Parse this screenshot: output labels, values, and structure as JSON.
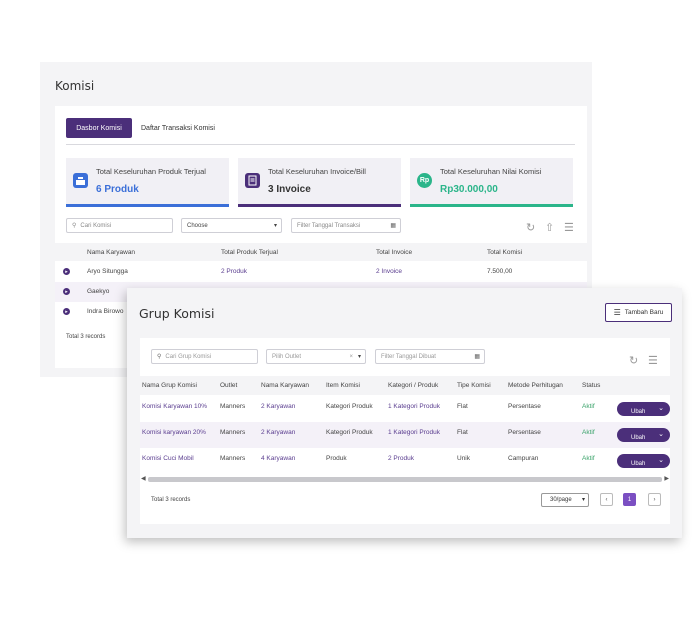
{
  "komisi": {
    "title": "Komisi",
    "tabs": [
      {
        "label": "Dasbor Komisi"
      },
      {
        "label": "Daftar Transaksi Komisi"
      }
    ],
    "stats": [
      {
        "label": "Total Keseluruhan Produk Terjual",
        "value": "6 Produk",
        "icon": "cash-register-icon",
        "color": "#3b6fd8"
      },
      {
        "label": "Total Keseluruhan Invoice/Bill",
        "value": "3 Invoice",
        "icon": "invoice-icon",
        "color": "#4b2f7a"
      },
      {
        "label": "Total Keseluruhan Nilai Komisi",
        "value": "Rp30.000,00",
        "icon": "money-bag-icon",
        "color": "#2bb58a"
      }
    ],
    "filters": {
      "search_placeholder": "Cari Komisi",
      "choose": "Choose",
      "date_placeholder": "Filter Tanggal Transaksi"
    },
    "table": {
      "headers": [
        "Nama Karyawan",
        "Total Produk Terjual",
        "Total Invoice",
        "Total Komisi"
      ],
      "rows": [
        [
          "Aryo Situngga",
          "2 Produk",
          "2 Invoice",
          "7.500,00"
        ],
        [
          "Gaekyo",
          "",
          "",
          ""
        ],
        [
          "Indra Birowo",
          "",
          "",
          ""
        ]
      ]
    },
    "total_records": "Total 3 records"
  },
  "grup": {
    "title": "Grup Komisi",
    "add_button": "Tambah Baru",
    "filters": {
      "search_placeholder": "Cari Grup Komisi",
      "outlet_placeholder": "Pilih Outlet",
      "date_placeholder": "Filter Tanggal Dibuat"
    },
    "table": {
      "headers": [
        "Nama Grup Komisi",
        "Outlet",
        "Nama Karyawan",
        "Item Komisi",
        "Kategori / Produk",
        "Tipe Komisi",
        "Metode Perhitugan",
        "Status"
      ],
      "rows": [
        [
          "Komisi Karyawan 10%",
          "Manners",
          "2 Karyawan",
          "Kategori Produk",
          "1 Kategori Produk",
          "Flat",
          "Persentase",
          "Aktif"
        ],
        [
          "Komisi karyawan 20%",
          "Manners",
          "2 Karyawan",
          "Kategori Produk",
          "1 Kategori Produk",
          "Flat",
          "Persentase",
          "Aktif"
        ],
        [
          "Komisi Cuci Mobil",
          "Manners",
          "4 Karyawan",
          "Produk",
          "2 Produk",
          "Unik",
          "Campuran",
          "Aktif"
        ]
      ],
      "action_label": "Ubah"
    },
    "total_records": "Total 3 records",
    "per_page": "30/page",
    "current_page": "1"
  }
}
